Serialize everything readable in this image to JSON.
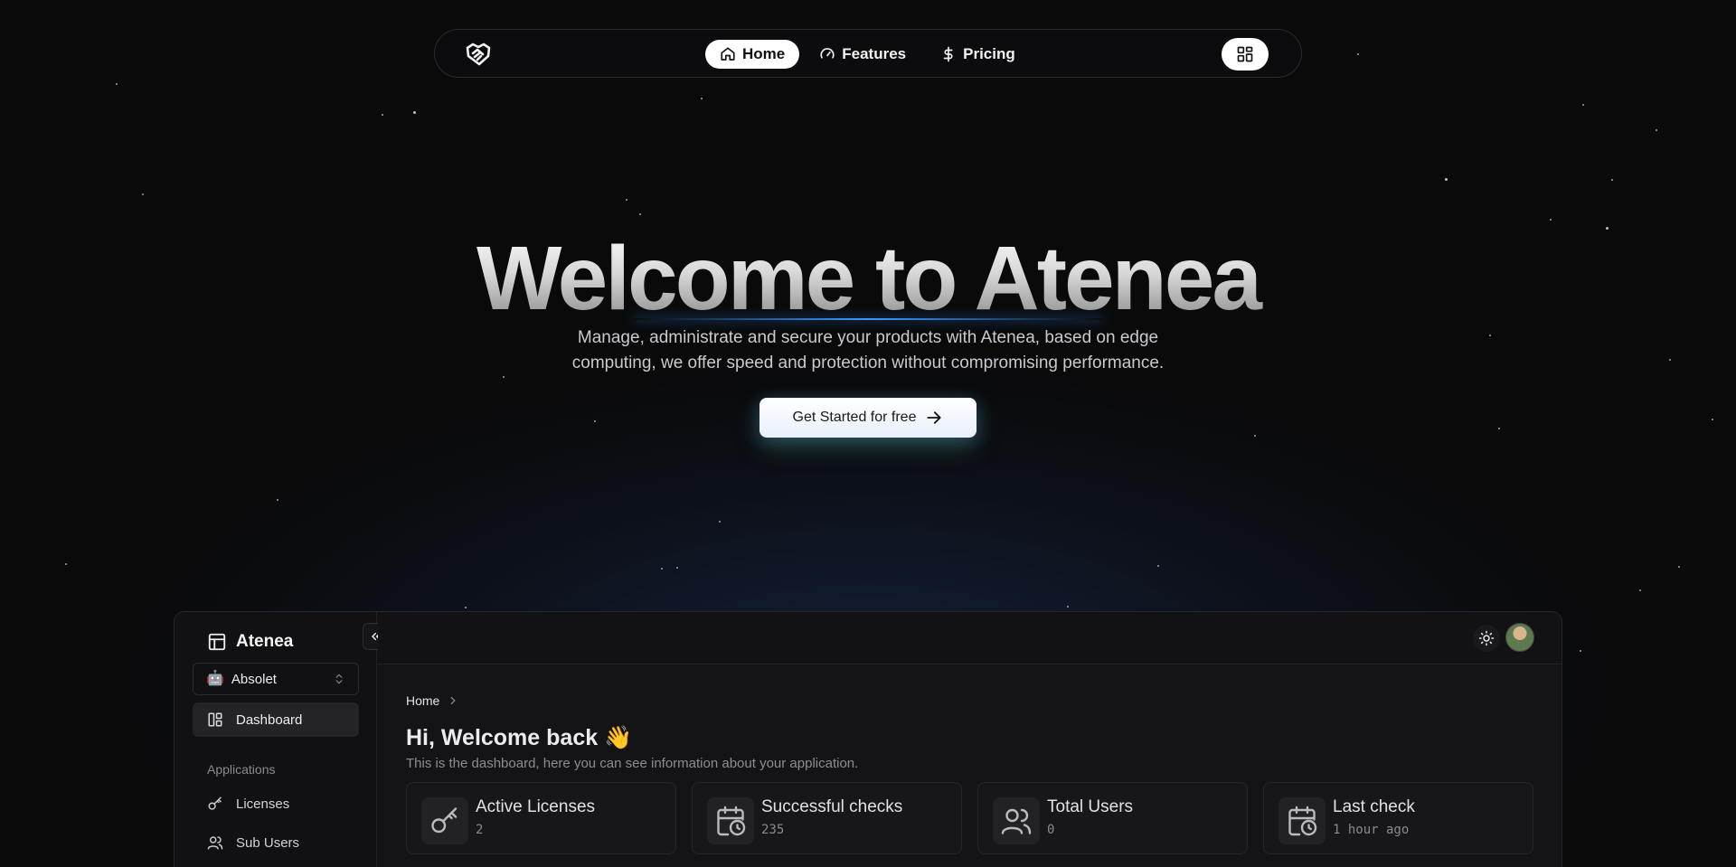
{
  "nav": {
    "logo_icon": "handshake-icon",
    "links": [
      {
        "label": "Home",
        "icon": "home-icon",
        "active": true
      },
      {
        "label": "Features",
        "icon": "gauge-icon",
        "active": false
      },
      {
        "label": "Pricing",
        "icon": "dollar-icon",
        "active": false
      }
    ],
    "menu_icon": "grid-icon"
  },
  "hero": {
    "title": "Welcome to Atenea",
    "subtitle_line1": "Manage, administrate and secure your products with Atenea, based on edge",
    "subtitle_line2": "computing, we offer speed and protection without compromising performance.",
    "cta_label": "Get Started for free"
  },
  "dashboard": {
    "brand": "Atenea",
    "project": {
      "name": "Absolet",
      "icon": "robot-icon"
    },
    "sidebar": {
      "items": [
        {
          "label": "Dashboard",
          "icon": "layout-icon",
          "active": true
        },
        {
          "label": "Licenses",
          "icon": "key-icon",
          "active": false
        },
        {
          "label": "Sub Users",
          "icon": "users-icon",
          "active": false
        }
      ],
      "section_label": "Applications"
    },
    "breadcrumb": {
      "home": "Home"
    },
    "greeting": "Hi, Welcome back 👋",
    "greeting_sub": "This is the dashboard, here you can see information about your application.",
    "cards": [
      {
        "title": "Active Licenses",
        "value": "2",
        "icon": "key-icon"
      },
      {
        "title": "Successful checks",
        "value": "235",
        "icon": "calendar-clock-icon"
      },
      {
        "title": "Total Users",
        "value": "0",
        "icon": "users-icon"
      },
      {
        "title": "Last check",
        "value": "1 hour ago",
        "icon": "calendar-clock-icon"
      }
    ]
  },
  "colors": {
    "accent_glow": "#3b9bff",
    "background": "#0a0a0b"
  }
}
